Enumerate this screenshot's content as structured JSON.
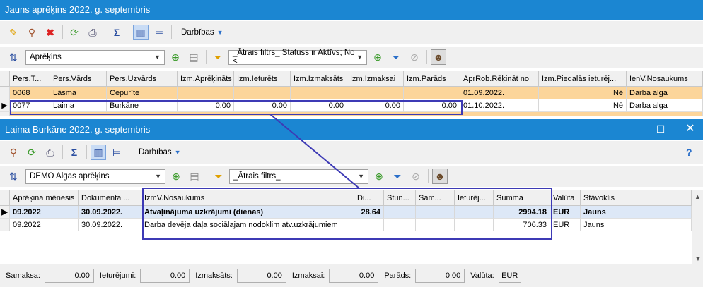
{
  "window1": {
    "title": "Jauns aprēķins  2022. g. septembris",
    "toolbar": {
      "actions_label": "Darbības"
    },
    "filter": {
      "view_value": "Aprēķins",
      "quick_filter": "_Ātrais filtrs_ Statuss ir Aktīvs; No <"
    },
    "columns": [
      "Pers.T...",
      "Pers.Vārds",
      "Pers.Uzvārds",
      "Izm.Aprēķināts",
      "Izm.Ieturēts",
      "Izm.Izmaksāts",
      "Izm.Izmaksai",
      "Izm.Parāds",
      "AprRob.Rēķināt no",
      "Izm.Piedalās ieturēj...",
      "IenV.Nosaukums"
    ],
    "rows": [
      [
        "0068",
        "Lāsma",
        "Cepurīte",
        "",
        "",
        "",
        "",
        "",
        "01.09.2022.",
        "Nē",
        "Darba alga"
      ],
      [
        "0077",
        "Laima",
        "Burkāne",
        "0.00",
        "0.00",
        "0.00",
        "0.00",
        "0.00",
        "01.10.2022.",
        "Nē",
        "Darba alga"
      ]
    ]
  },
  "window2": {
    "title": "Laima Burkāne 2022. g. septembris",
    "toolbar": {
      "actions_label": "Darbības",
      "help": "?"
    },
    "filter": {
      "view_value": "DEMO Algas aprēķins",
      "quick_filter": "_Ātrais filtrs_"
    },
    "columns": [
      "Aprēķina mēnesis",
      "Dokumenta ...",
      "IzmV.Nosaukums",
      "Di...",
      "Stun...",
      "Sam...",
      "Ieturēj...",
      "Summa",
      "Valūta",
      "Stāvoklis"
    ],
    "rows": [
      [
        "09.2022",
        "30.09.2022.",
        "Atvaļinājuma uzkrājumi (dienas)",
        "28.64",
        "",
        "",
        "",
        "2994.18",
        "EUR",
        "Jauns"
      ],
      [
        "09.2022",
        "30.09.2022.",
        "Darba devēja daļa sociālajam nodoklim atv.uzkrājumiem",
        "",
        "",
        "",
        "",
        "706.33",
        "EUR",
        "Jauns"
      ]
    ],
    "footer": {
      "samaksa_label": "Samaksa:",
      "samaksa_value": "0.00",
      "ieturejumi_label": "Ieturējumi:",
      "ieturejumi_value": "0.00",
      "izmaksats_label": "Izmaksāts:",
      "izmaksats_value": "0.00",
      "izmaksai_label": "Izmaksai:",
      "izmaksai_value": "0.00",
      "parads_label": "Parāds:",
      "parads_value": "0.00",
      "valuta_label": "Valūta:",
      "valuta_value": "EUR"
    }
  },
  "colors": {
    "titlebar": "#1b86d2",
    "highlight_row": "#fcd59a",
    "selected_row": "#dde8f7",
    "annotation": "#3d3ab5"
  }
}
